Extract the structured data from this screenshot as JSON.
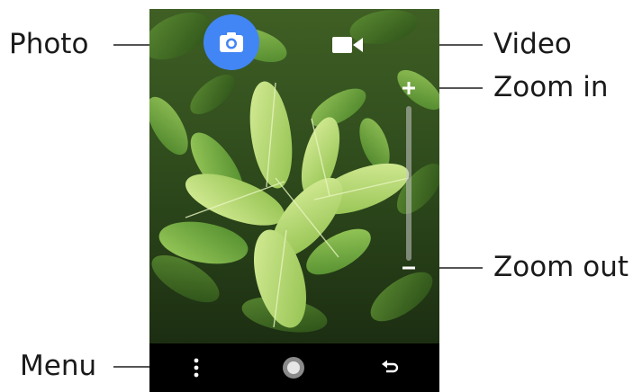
{
  "callouts": {
    "photo": "Photo",
    "video": "Video",
    "zoom_in": "Zoom in",
    "zoom_out": "Zoom out",
    "menu": "Menu"
  },
  "camera": {
    "mode_buttons": [
      {
        "name": "photo",
        "icon": "camera-icon",
        "active": true
      },
      {
        "name": "video",
        "icon": "videocam-icon",
        "active": false
      }
    ],
    "zoom": {
      "in_symbol": "+",
      "out_symbol": "−"
    }
  },
  "nav_bar": {
    "icons": [
      "more-vert-icon",
      "home-circle-icon",
      "back-arrow-icon"
    ]
  },
  "colors": {
    "accent": "#4285f4",
    "nav_bar": "#000000",
    "zoom_track": "#c8c8c8"
  }
}
